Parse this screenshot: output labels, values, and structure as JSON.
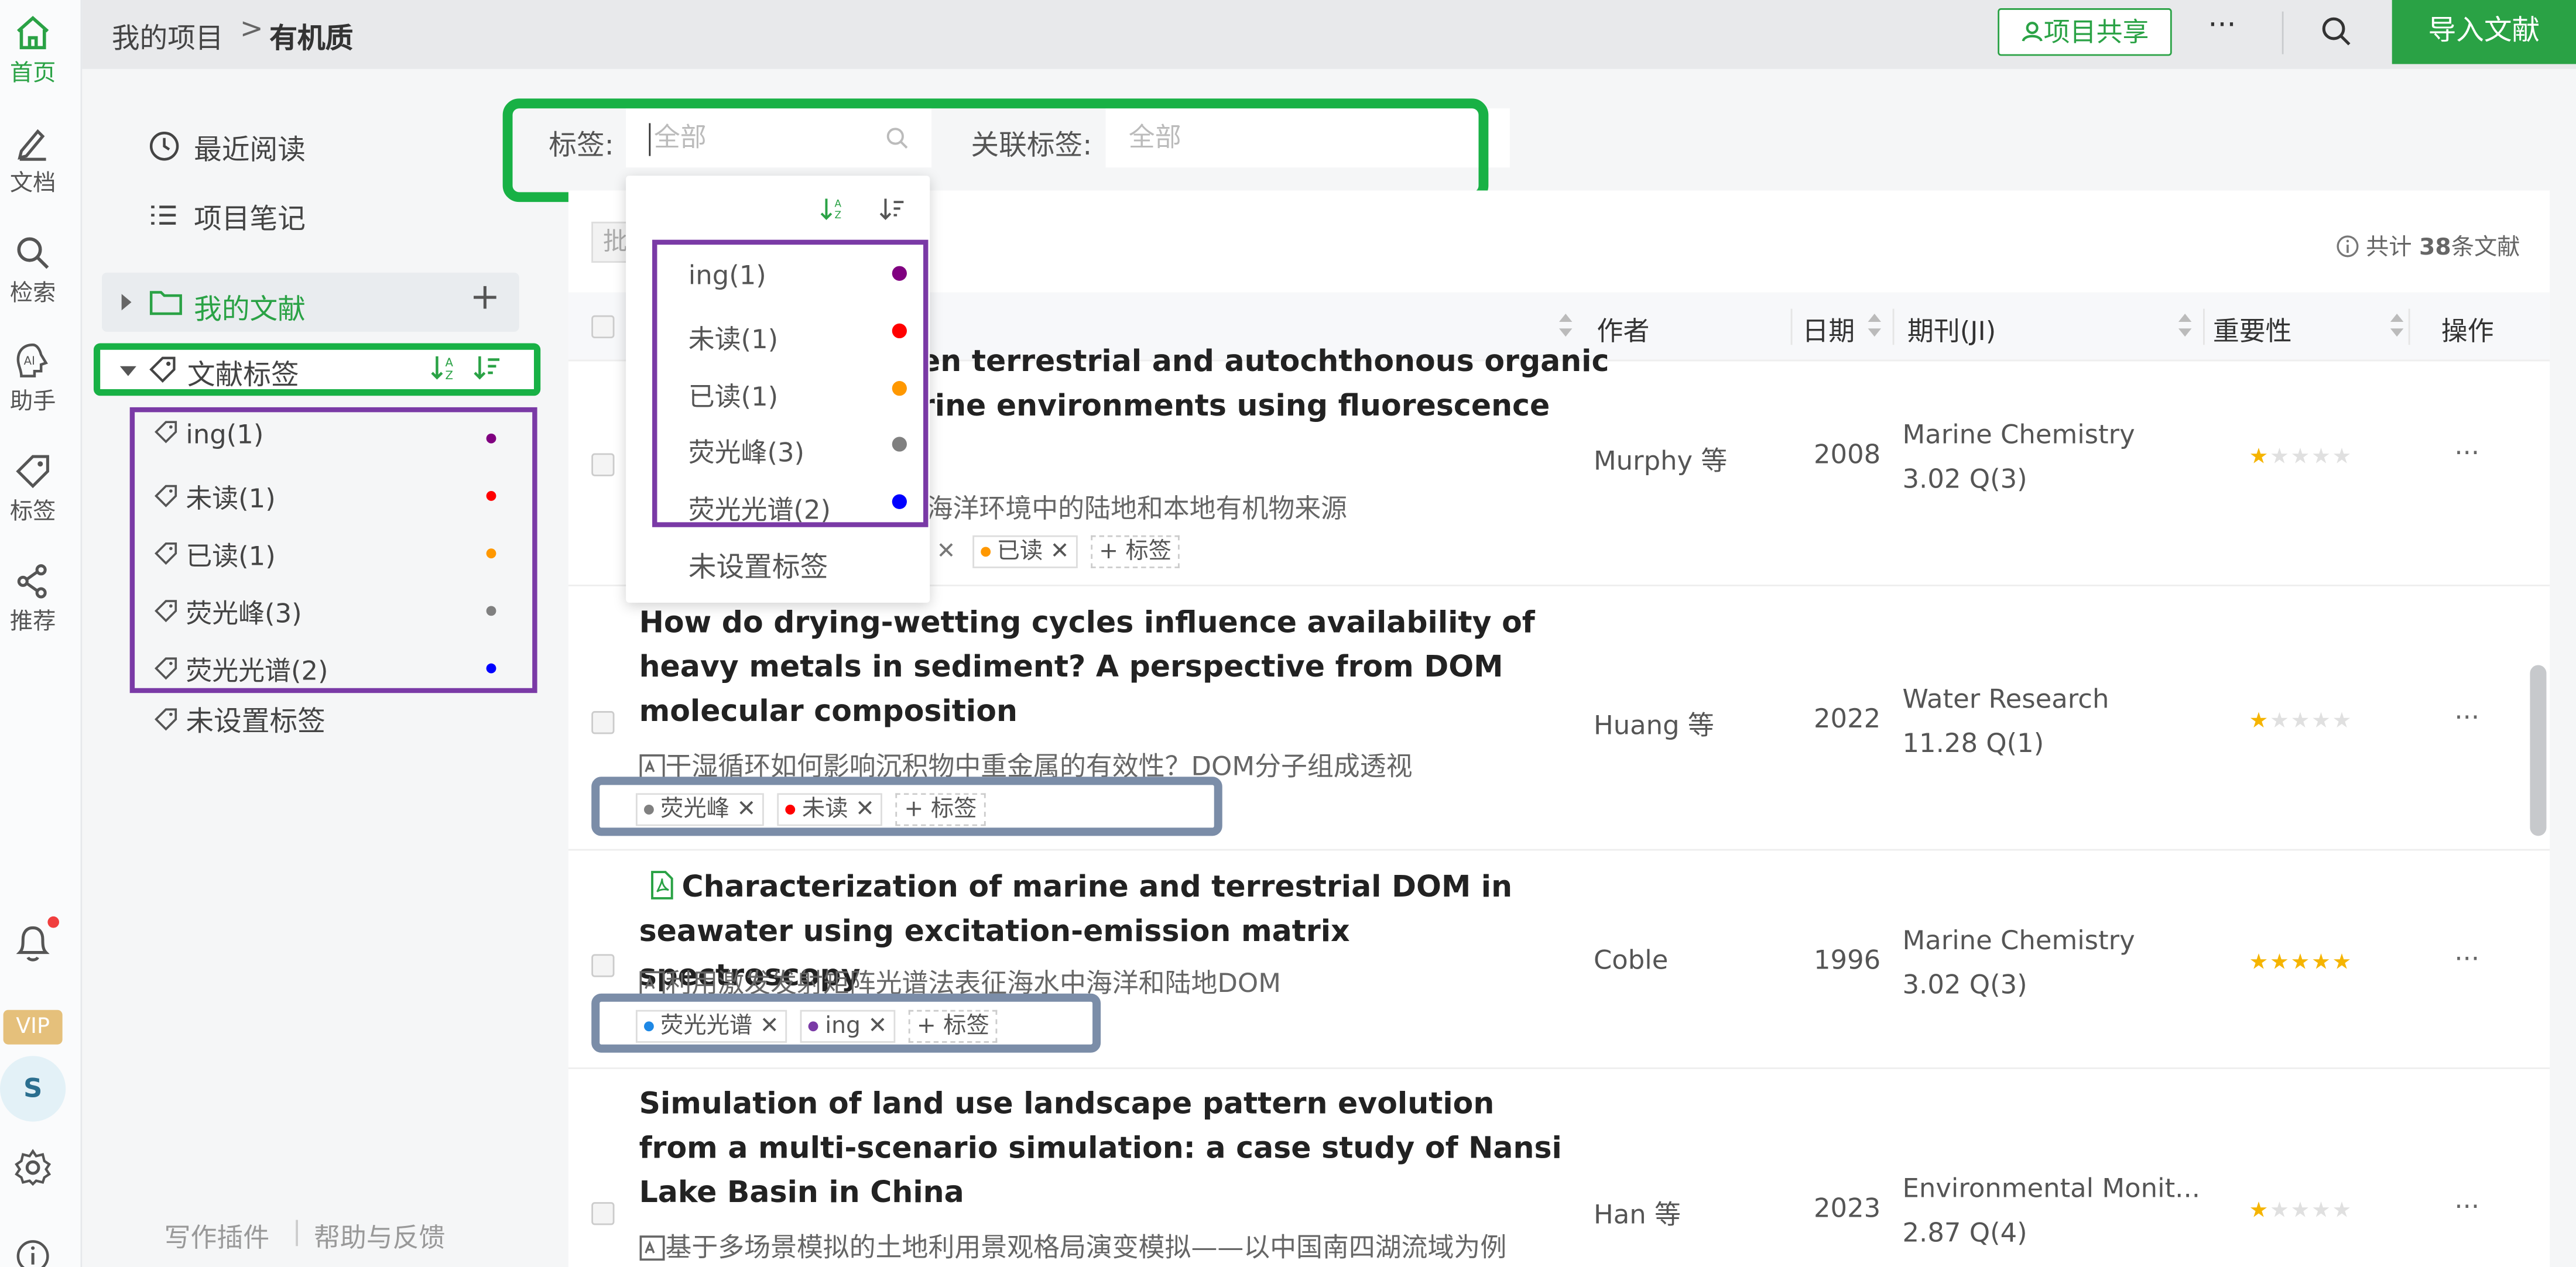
{
  "rail": {
    "items": [
      {
        "label": "首页",
        "icon": "home-icon",
        "active": true
      },
      {
        "label": "文档",
        "icon": "pencil-icon"
      },
      {
        "label": "检索",
        "icon": "search-icon"
      },
      {
        "label": "助手",
        "icon": "ai-assistant-icon"
      },
      {
        "label": "标签",
        "icon": "tag-icon"
      },
      {
        "label": "推荐",
        "icon": "share-icon"
      }
    ],
    "vip": "VIP",
    "avatar": "S"
  },
  "topbar": {
    "breadcrumb_root": "我的项目",
    "breadcrumb_sep": ">",
    "breadcrumb_current": "有机质",
    "share_label": "项目共享",
    "more": "···",
    "import_label": "导入文献"
  },
  "sidebar": {
    "recent": "最近阅读",
    "notes": "项目笔记",
    "mydocs": "我的文献",
    "add": "+",
    "tag_header": "文献标签",
    "tags": [
      {
        "label": "ing(1)",
        "color": "#800080"
      },
      {
        "label": "未读(1)",
        "color": "#ff0000"
      },
      {
        "label": "已读(1)",
        "color": "#ff9800"
      },
      {
        "label": "荧光峰(3)",
        "color": "#808080"
      },
      {
        "label": "荧光光谱(2)",
        "color": "#0000ff"
      }
    ],
    "untagged": "未设置标签",
    "footer_plugin": "写作插件",
    "footer_sep": "|",
    "footer_help": "帮助与反馈"
  },
  "filter": {
    "tag_label": "标签:",
    "tag_placeholder": "全部",
    "related_label": "关联标签:",
    "related_placeholder": "全部"
  },
  "dropdown": {
    "items": [
      {
        "label": "ing(1)",
        "color": "#800080"
      },
      {
        "label": "未读(1)",
        "color": "#ff0000"
      },
      {
        "label": "已读(1)",
        "color": "#ff9800"
      },
      {
        "label": "荧光峰(3)",
        "color": "#808080"
      },
      {
        "label": "荧光光谱(2)",
        "color": "#0000ff"
      }
    ],
    "untagged": "未设置标签"
  },
  "toolbar": {
    "batch": "批量",
    "total_prefix": "共计",
    "total_count": "38",
    "total_suffix": "条文献"
  },
  "table": {
    "headers": {
      "author": "作者",
      "date": "日期",
      "journal": "期刊(JI)",
      "importance": "重要性",
      "ops": "操作"
    },
    "rows": [
      {
        "title_line1": "een terrestrial and autochthonous organic",
        "title_line2": "arine environments using fluorescence",
        "subtitle": "海洋环境中的陆地和本地有机物来源",
        "author": "Murphy 等",
        "year": "2008",
        "journal": "Marine Chemistry",
        "impact": "3.02 Q(3)",
        "stars": 1,
        "tags": [
          {
            "label": "已读",
            "color": "#ff9800"
          }
        ],
        "add_tag": "+ 标签"
      },
      {
        "title": "How do drying-wetting cycles influence availability of heavy metals in sediment? A perspective from DOM molecular composition",
        "subtitle": "干湿循环如何影响沉积物中重金属的有效性？DOM分子组成透视",
        "author": "Huang 等",
        "year": "2022",
        "journal": "Water Research",
        "impact": "11.28 Q(1)",
        "stars": 1,
        "tags": [
          {
            "label": "荧光峰",
            "color": "#808080"
          },
          {
            "label": "未读",
            "color": "#ff0000"
          }
        ],
        "add_tag": "+ 标签"
      },
      {
        "title": "Characterization of marine and terrestrial DOM in seawater using excitation-emission matrix spectroscopy",
        "subtitle": "利用激发发射矩阵光谱法表征海水中海洋和陆地DOM",
        "author": "Coble",
        "year": "1996",
        "journal": "Marine Chemistry",
        "impact": "3.02 Q(3)",
        "stars": 5,
        "tags": [
          {
            "label": "荧光光谱",
            "color": "#1e88e5"
          },
          {
            "label": "ing",
            "color": "#7a3aa6"
          }
        ],
        "add_tag": "+ 标签"
      },
      {
        "title": "Simulation of land use landscape pattern evolution from a multi-scenario simulation: a case study of Nansi Lake Basin in China",
        "subtitle": "基于多场景模拟的土地利用景观格局演变模拟——以中国南四湖流域为例",
        "author": "Han 等",
        "year": "2023",
        "journal": "Environmental Monit...",
        "impact": "2.87 Q(4)",
        "stars": 1,
        "tags": [],
        "add_tag": ""
      }
    ]
  },
  "colors": {
    "accent": "#2aa245",
    "annotation_green": "#18b145",
    "annotation_purple": "#7a3aa6",
    "annotation_slate": "#7b8da8",
    "star_on": "#f5b400",
    "star_off": "#e0e0e0"
  }
}
